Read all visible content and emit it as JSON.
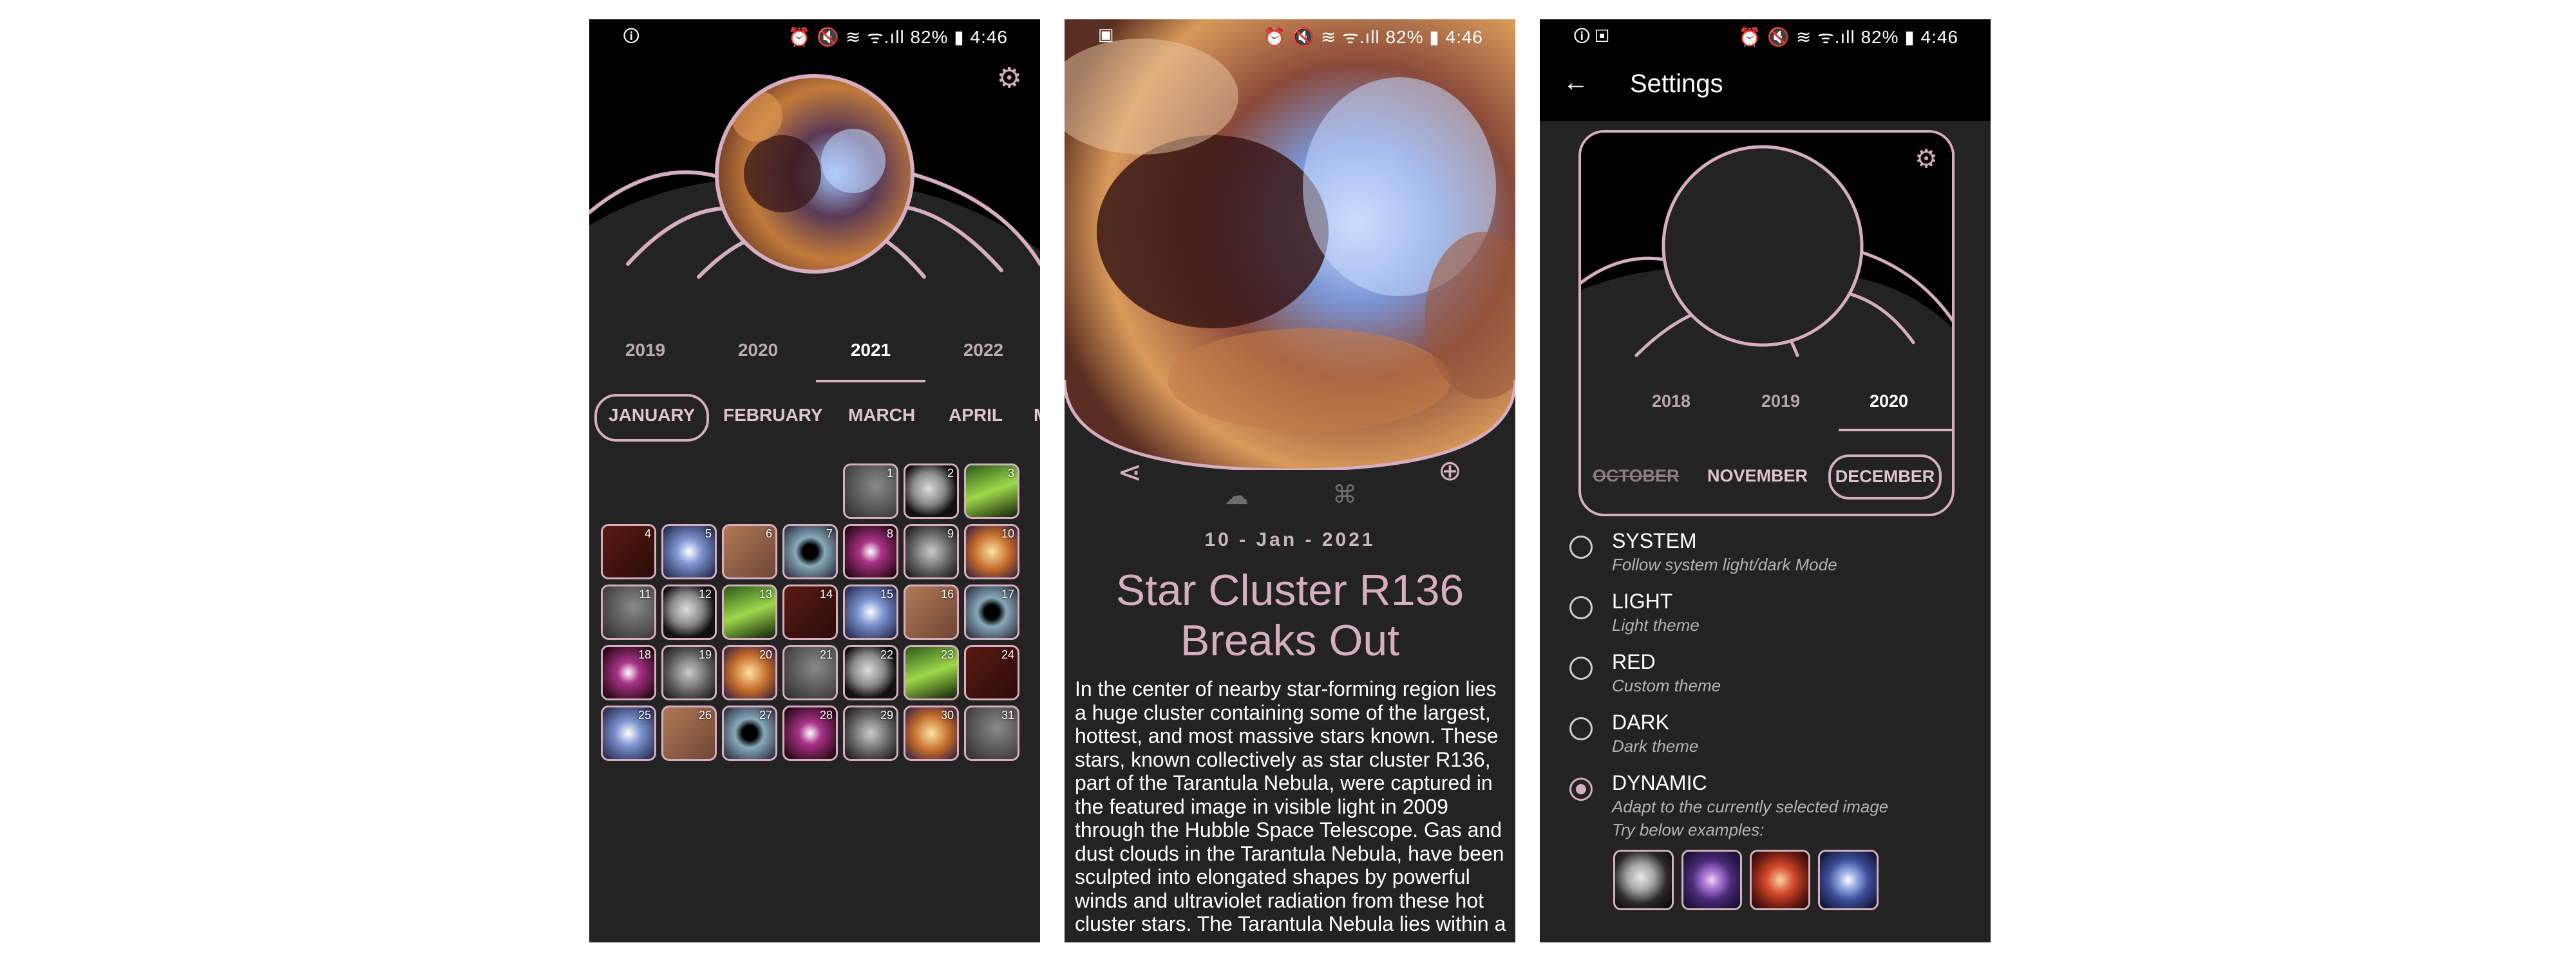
{
  "status": {
    "left1": "🛈",
    "left2": "▣",
    "right_icons": "⏰ 🔇 ≋ ᯤ.ıll",
    "battery": "82%",
    "time": "4:46"
  },
  "screen1": {
    "years": [
      "2019",
      "2020",
      "2021",
      "2022"
    ],
    "selected_year": "2021",
    "months": [
      "JANUARY",
      "FEBRUARY",
      "MARCH",
      "APRIL",
      "M"
    ],
    "selected_month": "JANUARY",
    "days": [
      "1",
      "2",
      "3",
      "4",
      "5",
      "6",
      "7",
      "8",
      "9",
      "10",
      "11",
      "12",
      "13",
      "14",
      "15",
      "16",
      "17",
      "18",
      "19",
      "20",
      "21",
      "22",
      "23",
      "24",
      "25",
      "26",
      "27",
      "28",
      "29",
      "30",
      "31"
    ],
    "first_weekday_index": 4
  },
  "screen2": {
    "date": "10 - Jan - 2021",
    "title": "Star Cluster R136 Breaks Out",
    "body": "In the center of nearby star-forming region lies a huge cluster containing some of the largest, hottest, and most massive stars known. These stars, known collectively as star cluster R136, part of the Tarantula Nebula, were captured in the featured image in visible light in 2009 through the Hubble Space Telescope. Gas and dust clouds in the Tarantula Nebula, have been sculpted into elongated shapes by powerful winds and ultraviolet radiation from these hot cluster stars.  The Tarantula Nebula lies within a",
    "icons": [
      "share-icon",
      "download-cloud-icon",
      "translate-icon",
      "zoom-image-icon"
    ]
  },
  "screen3": {
    "title": "Settings",
    "preview_years": [
      "2018",
      "2019",
      "2020"
    ],
    "preview_selected_year": "2020",
    "preview_months": [
      "OCTOBER",
      "NOVEMBER",
      "DECEMBER"
    ],
    "preview_selected_month": "DECEMBER",
    "options": [
      {
        "title": "SYSTEM",
        "subtitle": "Follow system light/dark Mode",
        "selected": false
      },
      {
        "title": "LIGHT",
        "subtitle": "Light theme",
        "selected": false
      },
      {
        "title": "RED",
        "subtitle": "Custom theme",
        "selected": false
      },
      {
        "title": "DARK",
        "subtitle": "Dark theme",
        "selected": false
      },
      {
        "title": "DYNAMIC",
        "subtitle": "Adapt to the currently selected image",
        "selected": true
      }
    ],
    "examples_label": "Try below examples:"
  },
  "colors": {
    "accent": "#d7aebf",
    "background": "#232323",
    "appbar": "#000000"
  }
}
